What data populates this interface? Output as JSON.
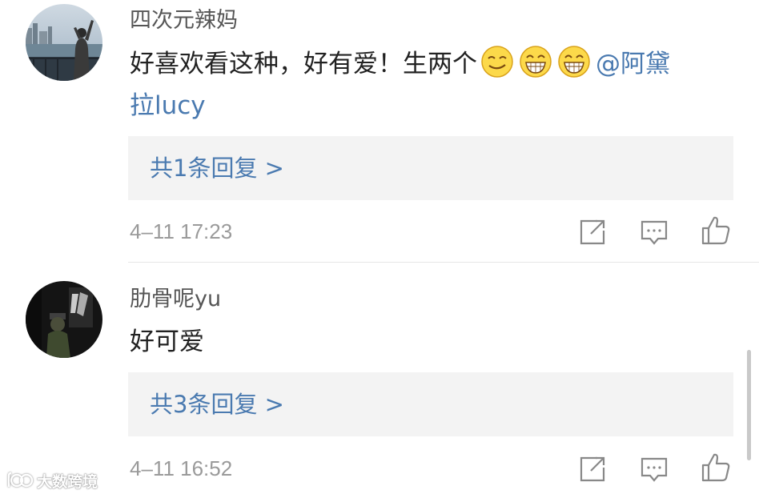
{
  "comments": [
    {
      "username": "四次元辣妈",
      "text_line1": "好喜欢看这种，好有爱！生两个",
      "emojis": [
        "smirk-emoji",
        "grin-emoji",
        "grin-emoji"
      ],
      "mention_part1": "@阿黛",
      "mention_part2": "拉lucy",
      "reply_label": "共1条回复 >",
      "time": "4–11 17:23",
      "avatar": "woman-at-harbor-avatar"
    },
    {
      "username": "肋骨呢yu",
      "text_line1": "好可爱",
      "reply_label": "共3条回复 >",
      "time": "4–11 16:52",
      "avatar": "dark-room-avatar"
    }
  ],
  "actions": {
    "share_icon": "share-icon",
    "comment_icon": "comment-icon",
    "like_icon": "like-icon"
  },
  "watermark": {
    "text": "大数跨境"
  },
  "colors": {
    "link": "#4a7ab0",
    "text": "#222222",
    "username": "#555555",
    "meta": "#9a9a9a",
    "reply_bg": "#f3f3f3"
  }
}
